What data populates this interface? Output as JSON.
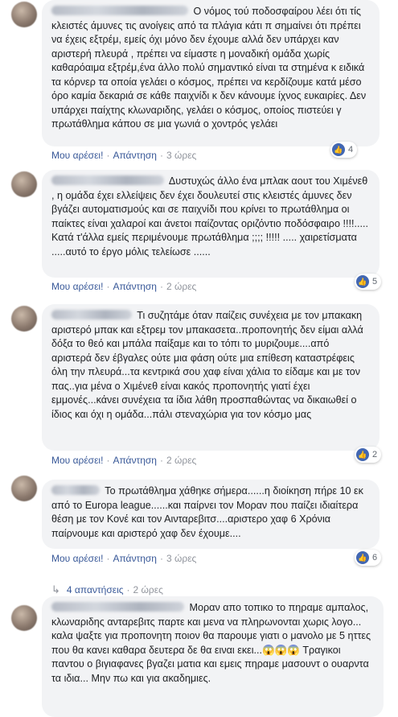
{
  "comments": [
    {
      "text": "Ο νόμος τού ποδοσφαίρου λέει ότι τίς κλειστές άμυνες τις ανοίγεις από τα πλάγια κάτι π σημαίνει ότι πρέπει να έχεις εξτρέμ, εμείς όχι μόνο δεν έχουμε αλλά δεν υπάρχει καν αριστερή πλευρά , πρέπει να είμαστε η μοναδική ομάδα χωρίς καθαρόαιμα εξτρέμ,ένα άλλο πολύ σημαντικό είναι τα στημένα κ ειδικά τα κόρνερ τα οποία γελάει ο κόσμος, πρέπει να κερδίζουμε κατά μέσο όρο καμία δεκαριά σε κάθε παιχνίδι κ δεν κάνουμε ίχνος ευκαιρίες. Δεν υπάρχει παίχτης κλωναριδης, γελάει ο κόσμος, οποίος πιστεύει γ πρωτάθλημα κάπου σε μια γωνιά ο χοντρός γελάει",
      "like_label": "Μου αρέσει!",
      "reply_label": "Απάντηση",
      "time": "3 ώρες",
      "reactions": "4"
    },
    {
      "text": "Δυστυχώς άλλο ένα μπλακ αουτ του Χιμένεθ , η ομάδα έχει ελλείψεις δεν έχει δουλευτεί στις κλειστές άμυνες δεν βγάζει αυτοματισμούς και σε παιχνίδι που κρίνει το πρωτάθλημα οι παίκτες είναι χαλαροί και άνετοι παίζοντας οριζόντιο ποδόσφαιρο !!!!..... Κατά τ'άλλα εμείς περιμένουμε πρωτάθλημα ;;;; !!!!! ..... χαιρετίσματα .....αυτό το έργο μόλις τελείωσε ......",
      "like_label": "Μου αρέσει!",
      "reply_label": "Απάντηση",
      "time": "2 ώρες",
      "reactions": "5"
    },
    {
      "text": "Τι συζητάμε όταν παίζεις συνέχεια με τον μπακακη αριστερό μπακ και εξτρεμ τον μπακασετα..προπονητής δεν είμαι αλλά δόξα το θεό και μπάλα παίξαμε και το τόπι το μυριζουμε....από αριστερά δεν έβγαλες ούτε μια φάση ούτε μια επίθεση καταστρέφεις όλη την πλευρά...τα κεντρικά σου χαφ είναι χάλια το είδαμε και με τον πας..για μένα ο Χιμένεθ είναι κακός προπονητής γιατί έχει εμμονές...κάνει συνέχεια τα ίδια λάθη προσπαθώντας να δικαιωθεί ο ίδιος και όχι η ομάδα...πάλι στεναχώρια για τον κόσμο μας",
      "like_label": "Μου αρέσει!",
      "reply_label": "Απάντηση",
      "time": "2 ώρες",
      "reactions": "2"
    },
    {
      "text": "Το πρωτάθλημα χάθηκε σήμερα......η διοίκηση πήρε 10 εκ από το Europa league......και παίρνει τον Μοραν που παίζει ιδιαίτερα θέση με τον Κονέ και τον Αινταρεβιτσ....αριστερο χαφ 6 Χρόνια παίρνουμε και αριστερό χαφ δεν έχουμε....",
      "like_label": "Μου αρέσει!",
      "reply_label": "Απάντηση",
      "time": "3 ώρες",
      "reactions": "6",
      "replies_label": "4 απαντήσεις",
      "replies_time": "2 ώρες"
    },
    {
      "text": "Μοραν απο τοπικο το πηραμε αμπαλος, κλωναριδης ανταρεβιτς παρτε και μενα να πληρωνονται χωρις λογο... καλα ψαξτε για προπονητη ποιον θα παρουμε γιατι ο μανολο με 5 ηττες που θα κανει καθαρα δευτερα δε θα ειναι εκει...😱😱😱 Τραγικοι παντου ο βιγιαφανες βγαζει ματια και εμεις πηραμε μασουντ ο ουαρντα τα ιδια... Μην πω και για ακαδημιες."
    }
  ],
  "icons": {
    "like": "thumbs-up-icon",
    "reply": "reply-arrow-icon"
  },
  "colors": {
    "link": "#385898",
    "bubble": "#f2f3f5",
    "like_badge": "#4267b2"
  }
}
